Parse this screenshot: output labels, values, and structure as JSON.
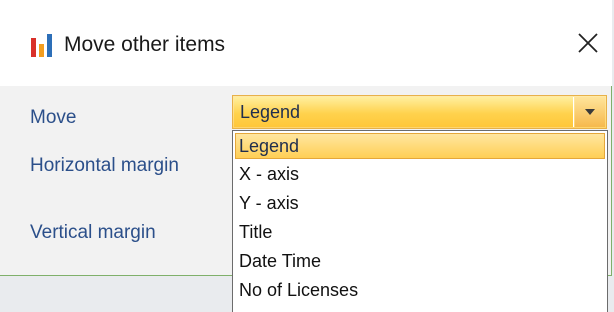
{
  "dialog": {
    "title": "Move other items",
    "close_glyph": "✕",
    "icon": "bar-chart-icon",
    "colors": {
      "label": "#2b4f8a",
      "accent_border": "#7fb06a",
      "highlight": "#ffd24d",
      "icon_red": "#d9302a",
      "icon_orange": "#f29d1f",
      "icon_blue": "#2d6fb8"
    }
  },
  "form": {
    "move_label": "Move",
    "horizontal_margin_label": "Horizontal margin",
    "vertical_margin_label": "Vertical margin",
    "move_select": {
      "value": "Legend",
      "arrow_icon": "dropdown-arrow-icon",
      "options": [
        "Legend",
        "X - axis",
        "Y - axis",
        "Title",
        "Date Time",
        "No of Licenses"
      ],
      "selected_index": 0
    }
  }
}
